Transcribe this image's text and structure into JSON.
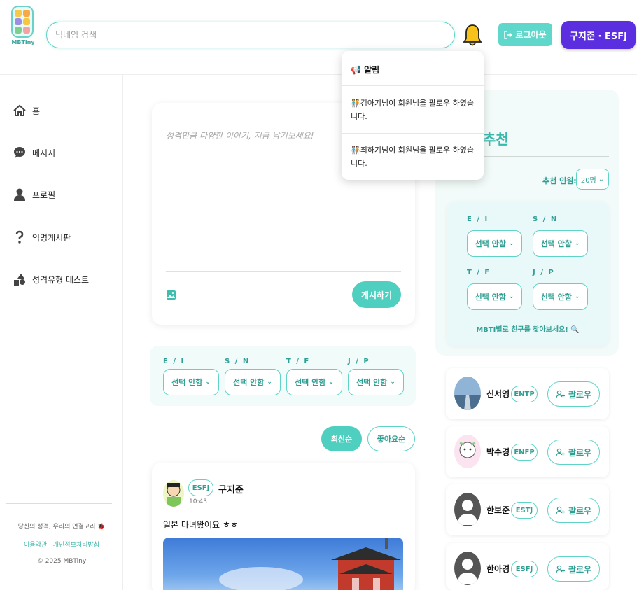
{
  "header": {
    "logo_text": "MBTiny",
    "search_placeholder": "닉네임 검색",
    "logout_label": "로그아웃",
    "user_label": "구지준 · ESFJ"
  },
  "sidebar": {
    "items": [
      {
        "label": "홈",
        "icon": "home-icon"
      },
      {
        "label": "메시지",
        "icon": "chat-icon"
      },
      {
        "label": "프로필",
        "icon": "person-icon"
      },
      {
        "label": "익명게시판",
        "icon": "question-icon"
      },
      {
        "label": "성격유형 테스트",
        "icon": "shapes-icon"
      }
    ],
    "footer_tagline": "당신의 성격, 우리의 연결고리 🐞",
    "footer_links": "이용약관 · 개인정보처리방침",
    "copyright": "© 2025 MBTiny"
  },
  "composer": {
    "placeholder": "성격만큼 다양한 이야기, 지금 남겨보세요!",
    "post_label": "게시하기"
  },
  "filter": {
    "ei_label": "E / I",
    "sn_label": "S / N",
    "tf_label": "T / F",
    "jp_label": "J / P",
    "select_value": "선택 안함"
  },
  "sort": {
    "newest": "최신순",
    "likes": "좋아요순"
  },
  "post": {
    "badge": "ESFJ",
    "author": "구지준",
    "time": "10:43",
    "text": "일본 다녀왔어요 ㅎㅎ"
  },
  "recommend": {
    "title": "추천",
    "count_label": "추천 인원:",
    "count_value": "20명",
    "ei_label": "E / I",
    "sn_label": "S / N",
    "tf_label": "T / F",
    "jp_label": "J / P",
    "select_value": "선택 안함",
    "hint": "MBTI별로 친구를 찾아보세요! 🔍",
    "follow_label": "팔로우",
    "users": [
      {
        "name": "신서영",
        "mbti": "ENTP"
      },
      {
        "name": "박수경",
        "mbti": "ENFP"
      },
      {
        "name": "한보준",
        "mbti": "ESTJ"
      },
      {
        "name": "한아경",
        "mbti": "ESFJ"
      }
    ]
  },
  "notifications": {
    "title": "📢 알림",
    "items": [
      "🧑‍🤝‍🧑김아기님이 회원님을 팔로우 하였습니다.",
      "🧑‍🤝‍🧑최하기님이 회원님을 팔로우 하였습니다."
    ]
  },
  "colors": {
    "accent": "#4fcfc0",
    "accent_dark": "#2f9f93",
    "user_button": "#5b2ee0"
  }
}
